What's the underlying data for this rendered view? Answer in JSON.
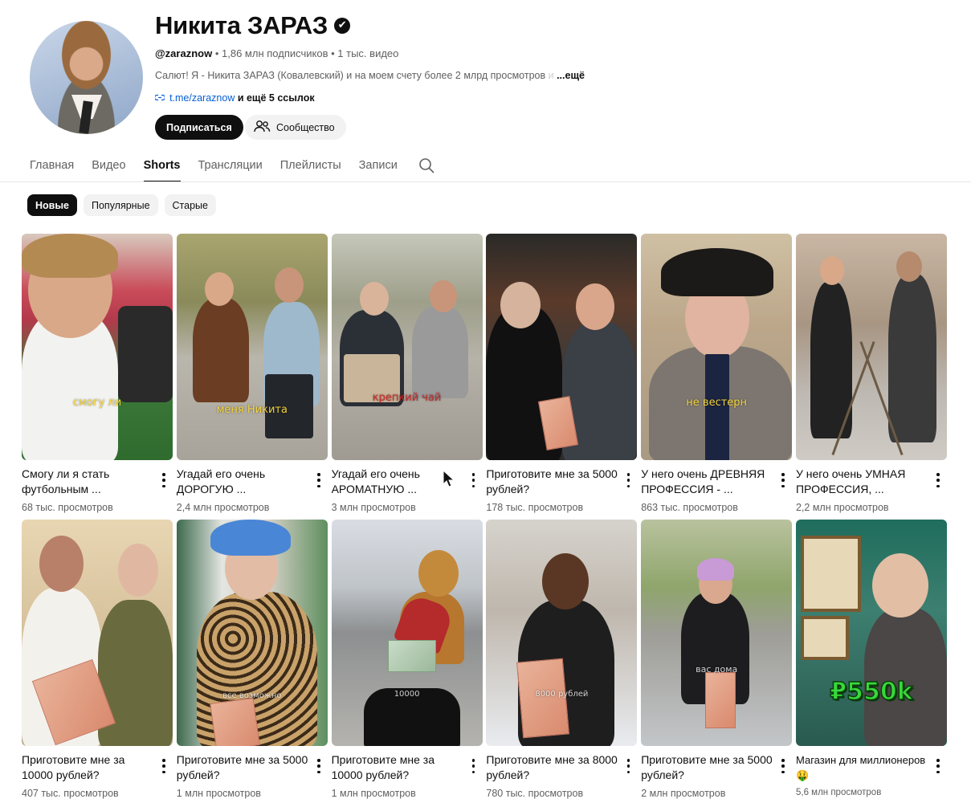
{
  "channel": {
    "name": "Никита ЗАРАЗ",
    "verified_icon": "✔",
    "handle": "@zaraznow",
    "subscribers": "1,86 млн подписчиков",
    "videos": "1 тыс. видео",
    "meta_sep": "•",
    "description": "Салют! Я - Никита ЗАРАЗ (Ковалевский) и на моем счету более 2 млрд просмотров",
    "description_fade": " и",
    "description_more": "...ещё",
    "link": "t.me/zaraznow",
    "link_more": "и ещё 5 ссылок",
    "subscribe_label": "Подписаться",
    "community_label": "Сообщество"
  },
  "tabs": [
    "Главная",
    "Видео",
    "Shorts",
    "Трансляции",
    "Плейлисты",
    "Записи"
  ],
  "active_tab": "Shorts",
  "chips": [
    "Новые",
    "Популярные",
    "Старые"
  ],
  "active_chip": "Новые",
  "shorts": [
    {
      "title": "Смогу ли я стать футбольным ...",
      "views": "68 тыс. просмотров",
      "overlay": "смогу ли"
    },
    {
      "title": "Угадай его очень ДОРОГУЮ ...",
      "views": "2,4 млн просмотров",
      "overlay": "меня Никита"
    },
    {
      "title": "Угадай его очень АРОМАТНУЮ ...",
      "views": "3 млн просмотров",
      "overlay": "крепкий чай"
    },
    {
      "title": "Приготовите мне за 5000 рублей?",
      "views": "178 тыс. просмотров",
      "overlay": ""
    },
    {
      "title": "У него очень ДРЕВНЯЯ ПРОФЕССИЯ - ...",
      "views": "863 тыс. просмотров",
      "overlay": "не вестерн"
    },
    {
      "title": "У него очень УМНАЯ ПРОФЕССИЯ, ...",
      "views": "2,2 млн просмотров",
      "overlay": ""
    },
    {
      "title": "Приготовите мне за 10000 рублей?",
      "views": "407 тыс. просмотров",
      "overlay": ""
    },
    {
      "title": "Приготовите мне за 5000 рублей?",
      "views": "1 млн просмотров",
      "overlay": "все возможно"
    },
    {
      "title": "Приготовите мне за 10000 рублей?",
      "views": "1 млн просмотров",
      "overlay": "10000"
    },
    {
      "title": "Приготовите мне за 8000 рублей?",
      "views": "780 тыс. просмотров",
      "overlay": "8000 рублей"
    },
    {
      "title": "Приготовите мне за 5000 рублей?",
      "views": "2 млн просмотров",
      "overlay": "вас дома"
    },
    {
      "title": "Магазин для миллионеров 🤑",
      "views": "5,6 млн просмотров",
      "overlay": "₽550k"
    }
  ],
  "icons": {
    "link": "link-icon",
    "community": "people-icon",
    "search": "search-icon",
    "more": "more-vert-icon"
  }
}
